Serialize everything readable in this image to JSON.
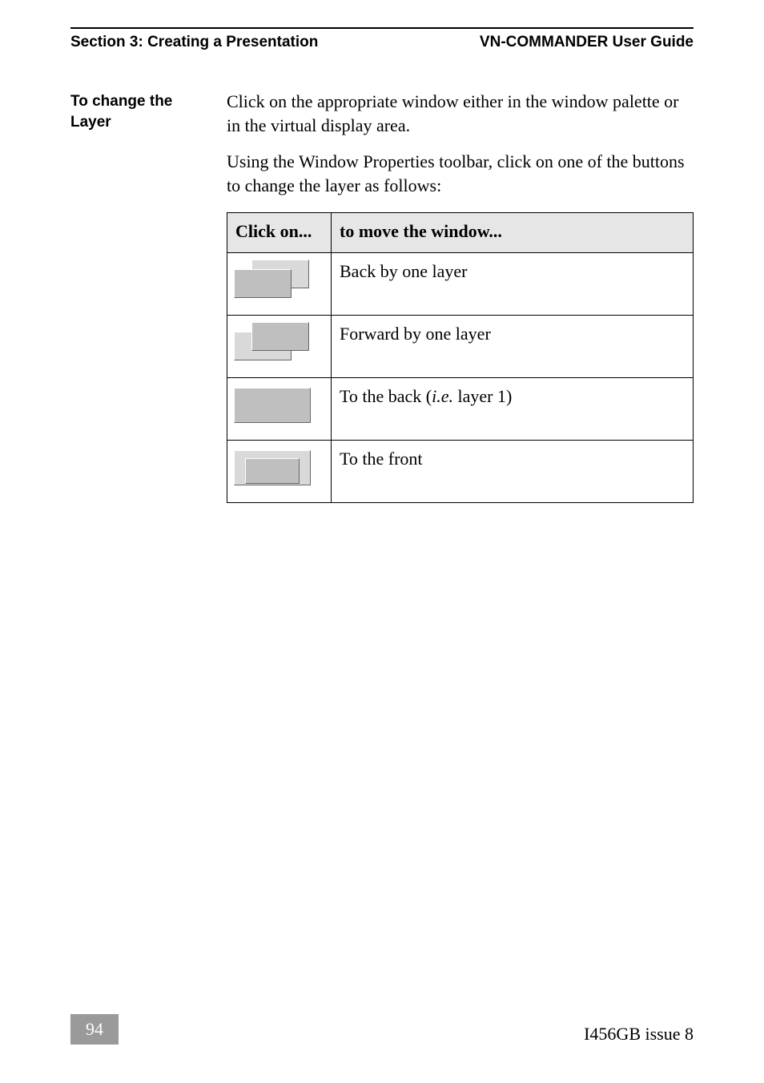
{
  "header": {
    "section": "Section 3: Creating a Presentation",
    "guide": "VN-COMMANDER User Guide"
  },
  "sidehead": "To change the Layer",
  "paragraphs": {
    "p1": "Click on the appropriate window either in the window palette or in the virtual display area.",
    "p2": "Using the Window Properties toolbar, click on one of the buttons to change the layer as follows:"
  },
  "table": {
    "headers": {
      "col1": "Click on...",
      "col2": "to move the window..."
    },
    "rows": [
      {
        "icon": "back-one-layer-icon",
        "desc": "Back by one layer"
      },
      {
        "icon": "forward-one-layer-icon",
        "desc": "Forward by one layer"
      },
      {
        "icon": "send-to-back-icon",
        "desc_pre": "To the back (",
        "desc_ie": "i.e.",
        "desc_post": " layer 1)"
      },
      {
        "icon": "bring-to-front-icon",
        "desc": "To the front"
      }
    ]
  },
  "footer": {
    "page": "94",
    "doc": "I456GB issue 8"
  }
}
